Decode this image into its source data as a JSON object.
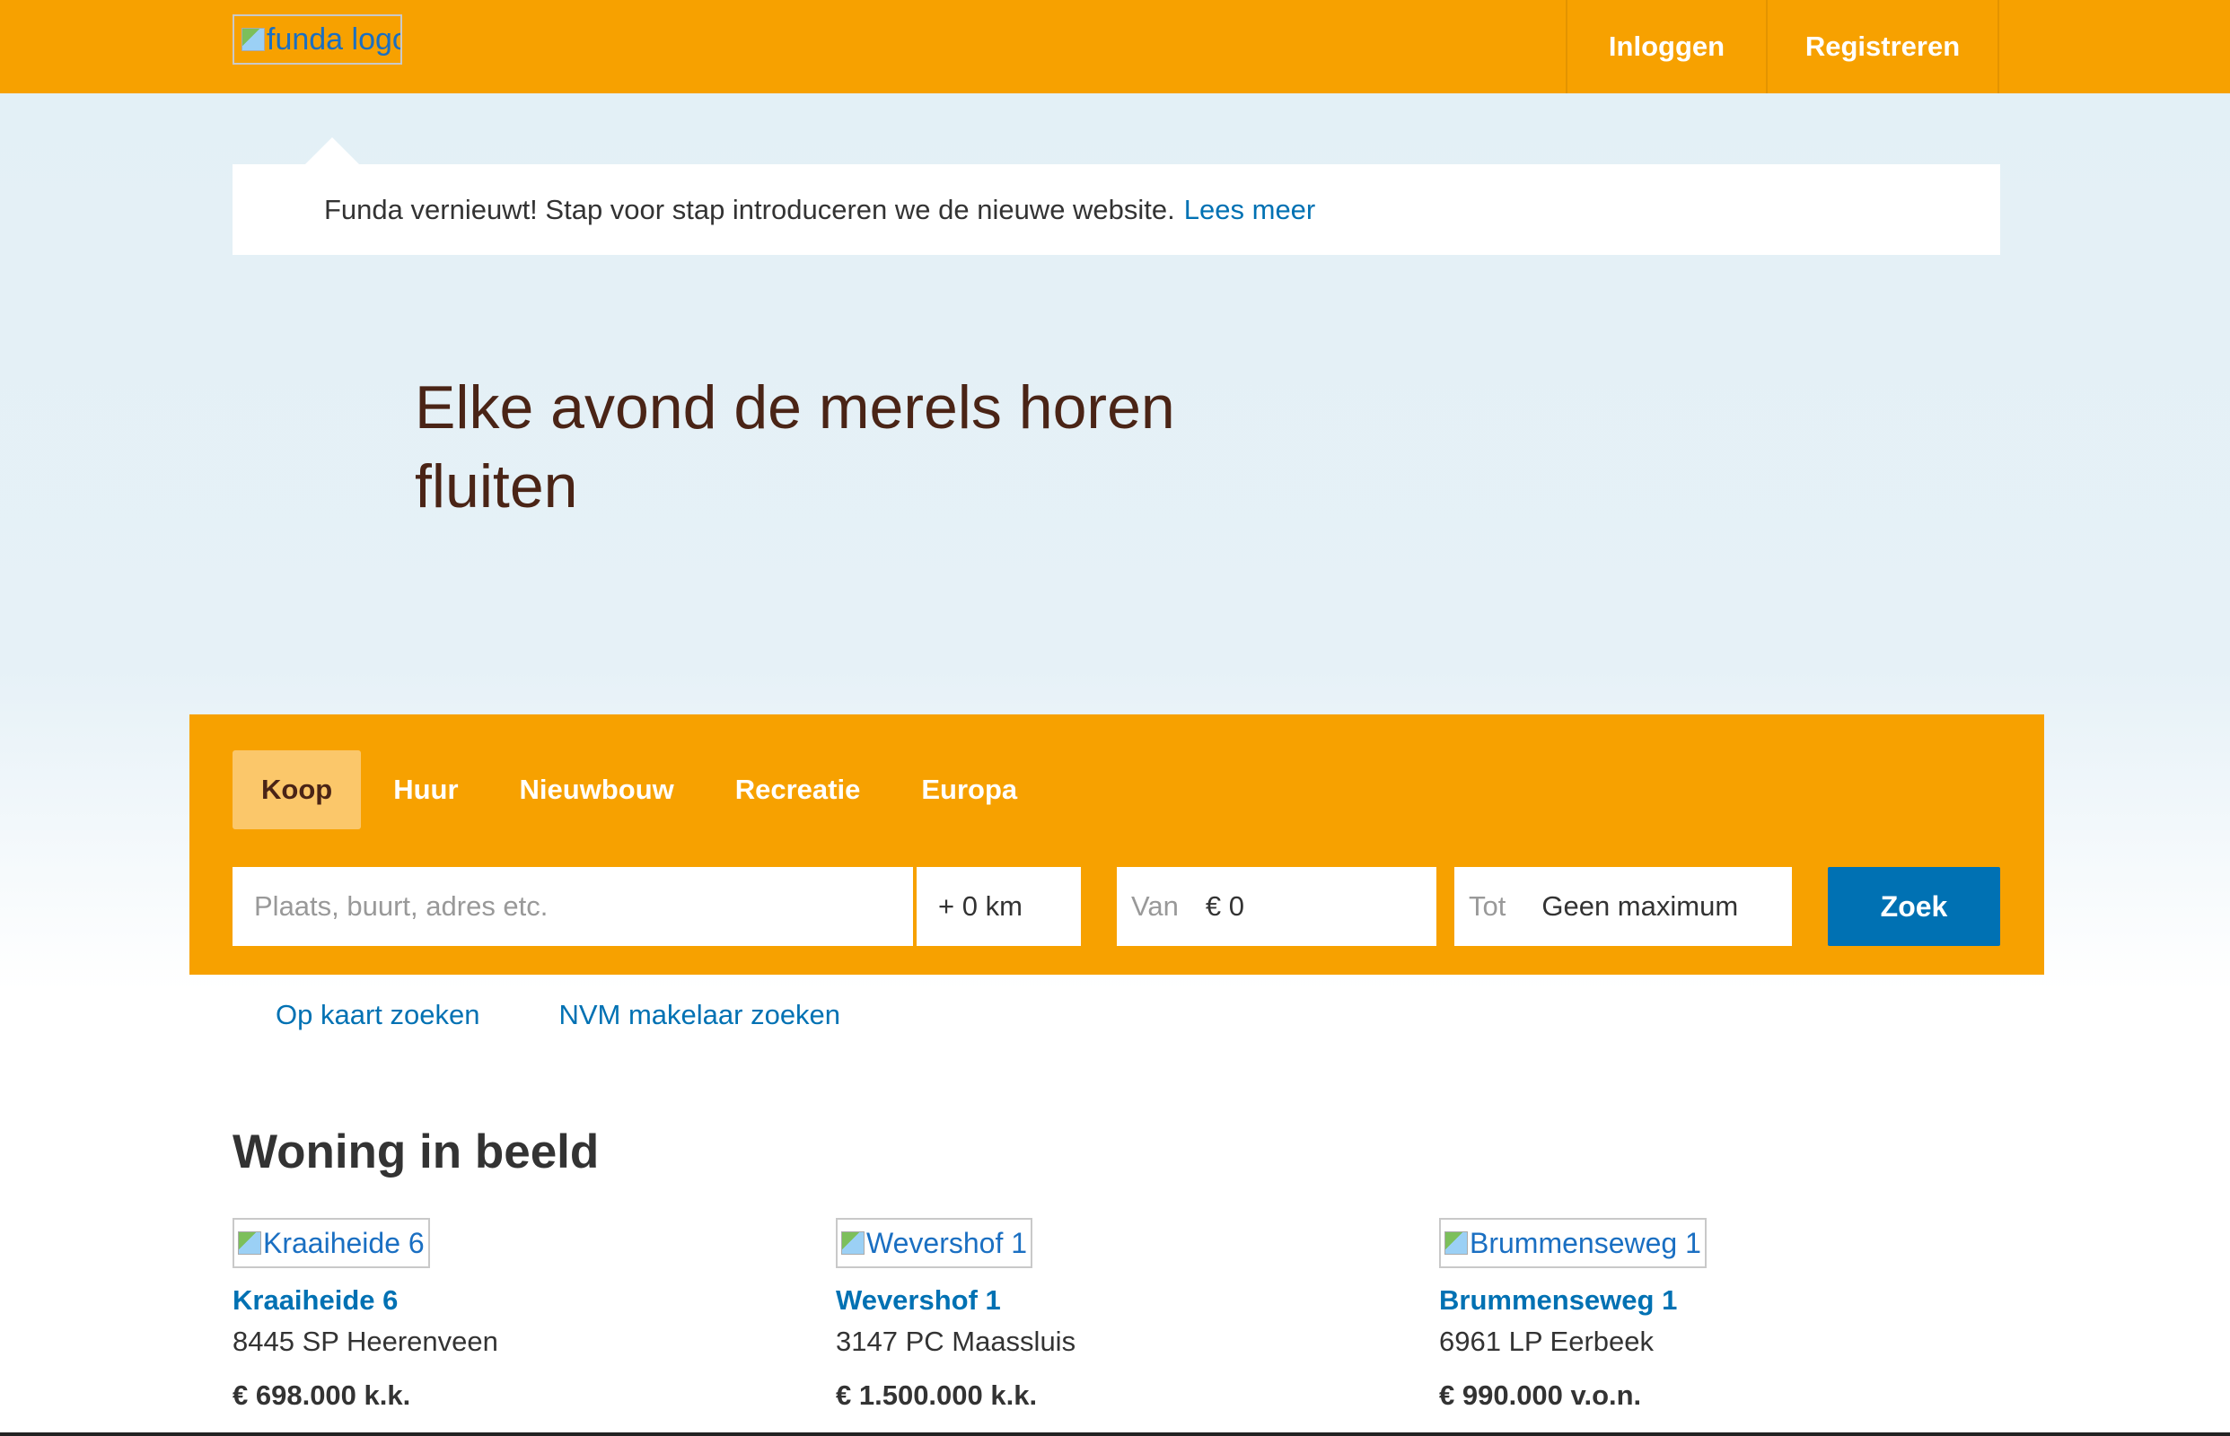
{
  "header": {
    "logo_alt": "funda logo",
    "login": "Inloggen",
    "register": "Registreren",
    "brand_color": "#f7a100"
  },
  "notice": {
    "text": "Funda vernieuwt! Stap voor stap introduceren we de nieuwe website.",
    "link": "Lees meer"
  },
  "hero": {
    "title": "Elke avond de merels horen fluiten"
  },
  "search": {
    "tabs": [
      {
        "label": "Koop",
        "active": true
      },
      {
        "label": "Huur",
        "active": false
      },
      {
        "label": "Nieuwbouw",
        "active": false
      },
      {
        "label": "Recreatie",
        "active": false
      },
      {
        "label": "Europa",
        "active": false
      }
    ],
    "place_placeholder": "Plaats, buurt, adres etc.",
    "radius": "+ 0 km",
    "from_label": "Van",
    "from_value": "€ 0",
    "to_label": "Tot",
    "to_value": "Geen maximum",
    "submit": "Zoek",
    "accent_color": "#0071b3"
  },
  "links": {
    "map_search": "Op kaart zoeken",
    "nvm_search": "NVM makelaar zoeken"
  },
  "featured": {
    "title": "Woning in beeld",
    "items": [
      {
        "image_alt": "Kraaiheide 6",
        "name": "Kraaiheide 6",
        "address": "8445 SP Heerenveen",
        "price": "€ 698.000 k.k."
      },
      {
        "image_alt": "Wevershof 1",
        "name": "Wevershof 1",
        "address": "3147 PC Maassluis",
        "price": "€ 1.500.000 k.k."
      },
      {
        "image_alt": "Brummenseweg 1",
        "name": "Brummenseweg 1",
        "address": "6961 LP Eerbeek",
        "price": "€ 990.000 v.o.n."
      }
    ]
  }
}
